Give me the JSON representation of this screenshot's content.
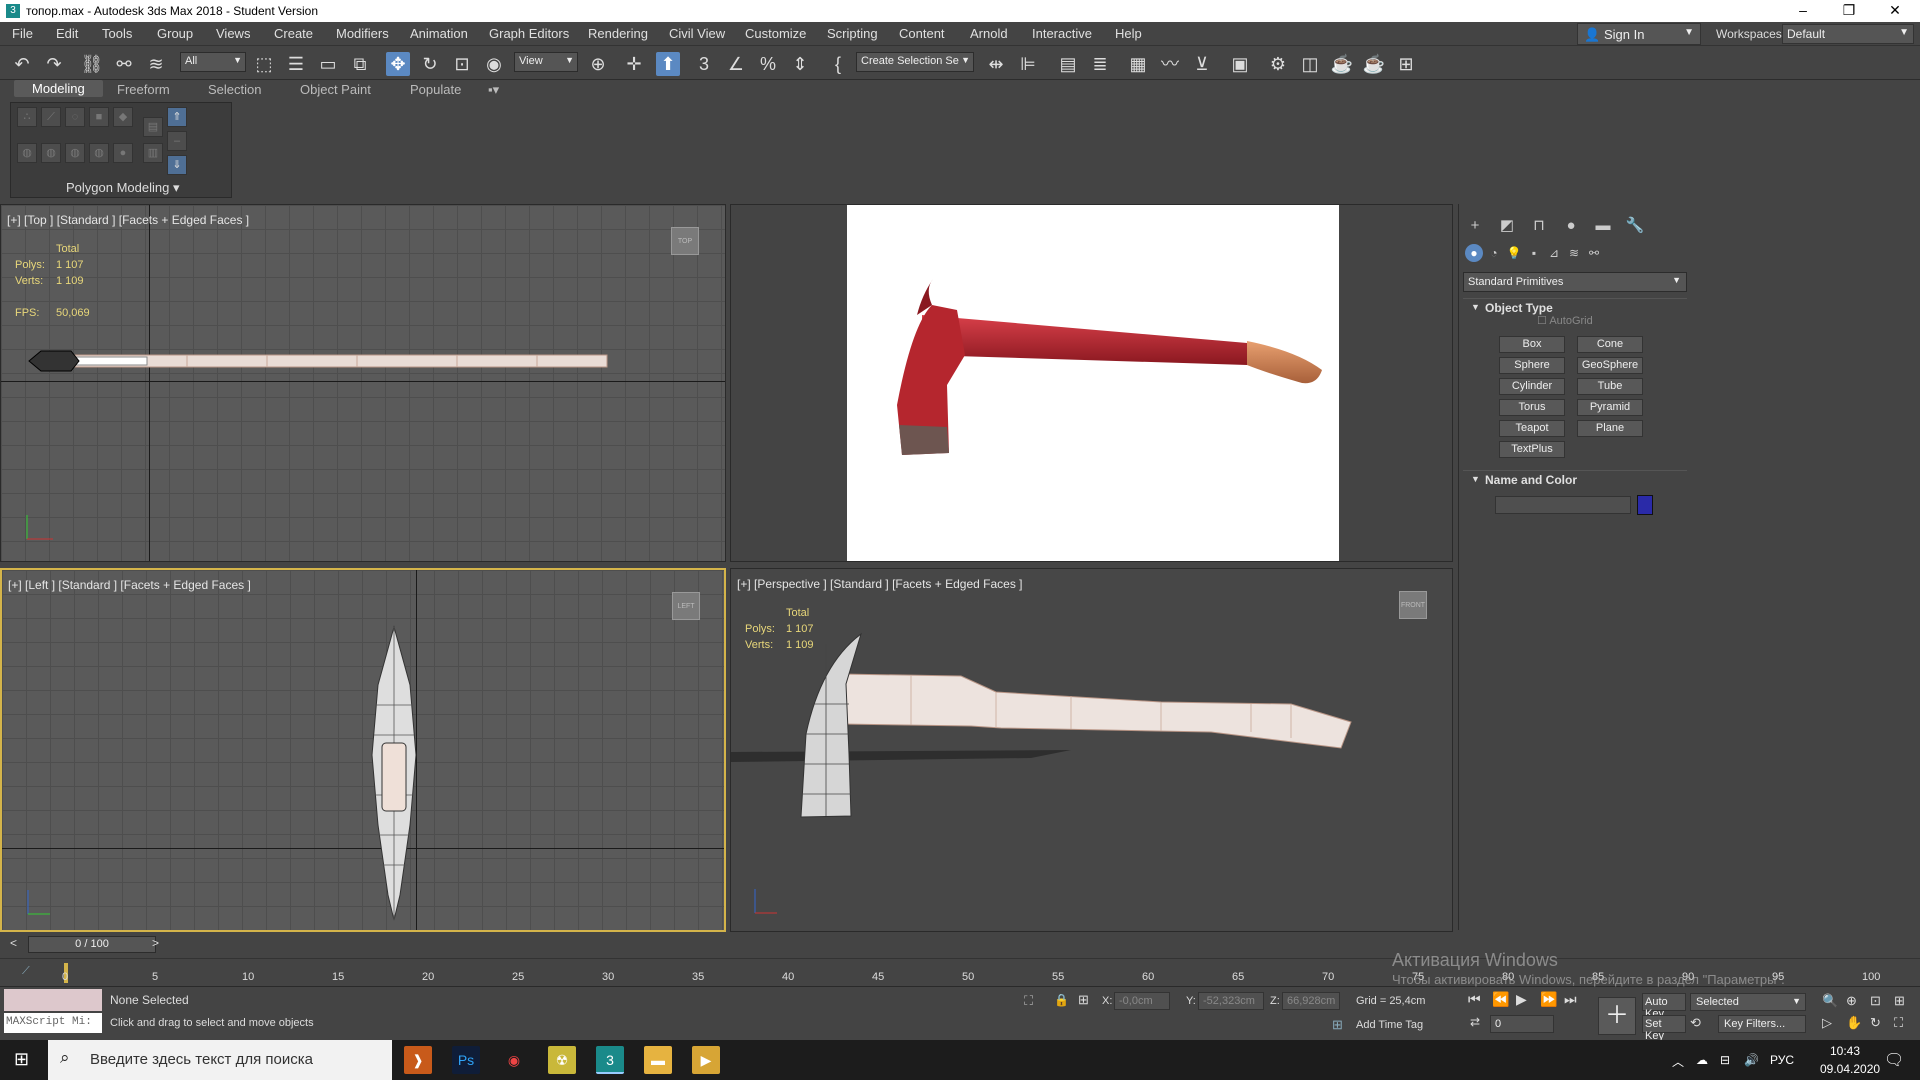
{
  "title_bar": {
    "title": "топор.max - Autodesk 3ds Max 2018 - Student Version",
    "app_icon": "3",
    "minimize": "–",
    "restore": "❐",
    "close": "✕"
  },
  "menu": {
    "items": [
      "File",
      "Edit",
      "Tools",
      "Group",
      "Views",
      "Create",
      "Modifiers",
      "Animation",
      "Graph Editors",
      "Rendering",
      "Civil View",
      "Customize",
      "Scripting",
      "Content",
      "Arnold",
      "Interactive",
      "Help"
    ]
  },
  "account": {
    "sign_in": "Sign In",
    "workspaces_label": "Workspaces:",
    "workspace": "Default"
  },
  "toolbar": {
    "filter": "All",
    "ref_coord": "View",
    "selection_set": "Create Selection Se"
  },
  "ribbon": {
    "tabs": [
      "Modeling",
      "Freeform",
      "Selection",
      "Object Paint",
      "Populate"
    ],
    "panel_label": "Polygon Modeling"
  },
  "viewports": {
    "top": {
      "label": "[+] [Top ] [Standard ] [Facets + Edged Faces ]",
      "cube": "TOP"
    },
    "left": {
      "label": "[+] [Left ] [Standard ] [Facets + Edged Faces ]",
      "cube": "LEFT"
    },
    "perspective": {
      "label": "[+] [Perspective ] [Standard ] [Facets + Edged Faces ]",
      "cube": "FRONT"
    },
    "stats": {
      "total": "Total",
      "polys_label": "Polys:",
      "polys": "1 107",
      "verts_label": "Verts:",
      "verts": "1 109",
      "fps_label": "FPS:",
      "fps": "50,069"
    }
  },
  "command_panel": {
    "category": "Standard Primitives",
    "object_type_title": "Object Type",
    "autogrid": "AutoGrid",
    "primitives": [
      "Box",
      "Cone",
      "Sphere",
      "GeoSphere",
      "Cylinder",
      "Tube",
      "Torus",
      "Pyramid",
      "Teapot",
      "Plane",
      "TextPlus"
    ],
    "name_color_title": "Name and Color",
    "object_color": "#2a2aa8"
  },
  "timeline": {
    "frame": "0 / 100",
    "ticks": [
      "0",
      "5",
      "10",
      "15",
      "20",
      "25",
      "30",
      "35",
      "40",
      "45",
      "50",
      "55",
      "60",
      "65",
      "70",
      "75",
      "80",
      "85",
      "90",
      "95",
      "100"
    ]
  },
  "status": {
    "maxscript": "MAXScript Mi:",
    "selection": "None Selected",
    "prompt": "Click and drag to select and move objects",
    "x_label": "X:",
    "x": "-0,0cm",
    "y_label": "Y:",
    "y": "-52,323cm",
    "z_label": "Z:",
    "z": "66,928cm",
    "grid": "Grid = 25,4cm",
    "add_time_tag": "Add Time Tag",
    "auto_key": "Auto Key",
    "key_mode": "Selected",
    "set_key": "Set Key",
    "key_filters": "Key Filters...",
    "frame_value": "0"
  },
  "watermark": {
    "line1": "Активация Windows",
    "line2": "Чтобы активировать Windows, перейдите в раздел \"Параметры\"."
  },
  "taskbar": {
    "search_placeholder": "Введите здесь текст для поиска",
    "lang": "РУС",
    "time": "10:43",
    "date": "09.04.2020"
  }
}
